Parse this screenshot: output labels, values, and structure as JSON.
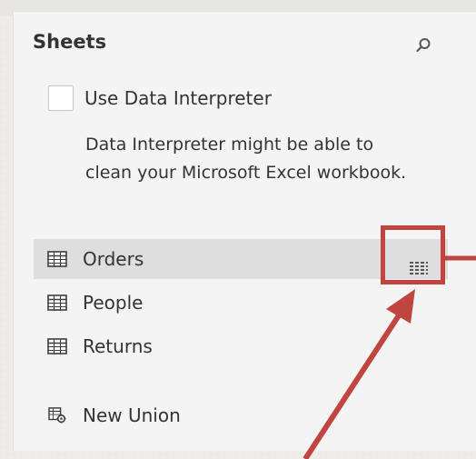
{
  "panel": {
    "title": "Sheets",
    "search_icon": "search-icon"
  },
  "interpreter": {
    "label": "Use Data Interpreter",
    "checked": false,
    "description": "Data Interpreter might be able to clean your Microsoft Excel workbook."
  },
  "sheets": [
    {
      "label": "Orders",
      "icon": "table-icon",
      "selected": true
    },
    {
      "label": "People",
      "icon": "table-icon",
      "selected": false
    },
    {
      "label": "Returns",
      "icon": "table-icon",
      "selected": false
    }
  ],
  "new_union": {
    "label": "New Union",
    "icon": "union-icon"
  },
  "grid_view_icon": "grid-view-icon",
  "colors": {
    "highlight": "#c0443f",
    "selected_row": "#dedede",
    "panel_bg": "#f4f4f4"
  }
}
